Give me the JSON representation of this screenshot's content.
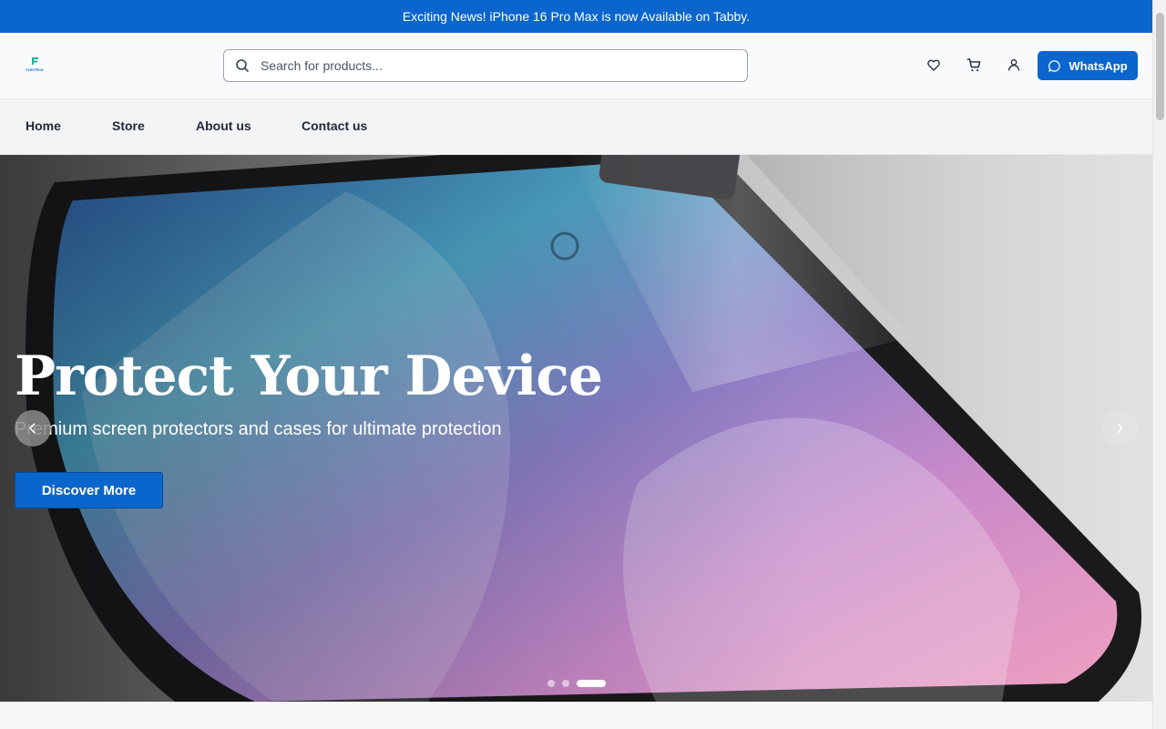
{
  "announcement": {
    "text": "Exciting News! iPhone 16 Pro Max is now Available on Tabby."
  },
  "header": {
    "logo_text": "FLEXTECH",
    "search": {
      "placeholder": "Search for products...",
      "value": ""
    },
    "icons": [
      "heart-icon",
      "cart-icon",
      "user-icon"
    ],
    "whatsapp_label": "WhatsApp"
  },
  "nav": {
    "items": [
      {
        "label": "Home"
      },
      {
        "label": "Store"
      },
      {
        "label": "About us"
      },
      {
        "label": "Contact us"
      }
    ]
  },
  "hero": {
    "title": "Protect Your Device",
    "subtitle": "Premium screen protectors and cases for ultimate protection",
    "cta_label": "Discover More",
    "slide_count": 3,
    "active_slide": 3
  },
  "colors": {
    "primary": "#0a66cc",
    "nav_bg": "#f3f4f6",
    "header_bg": "#f9fafb"
  }
}
